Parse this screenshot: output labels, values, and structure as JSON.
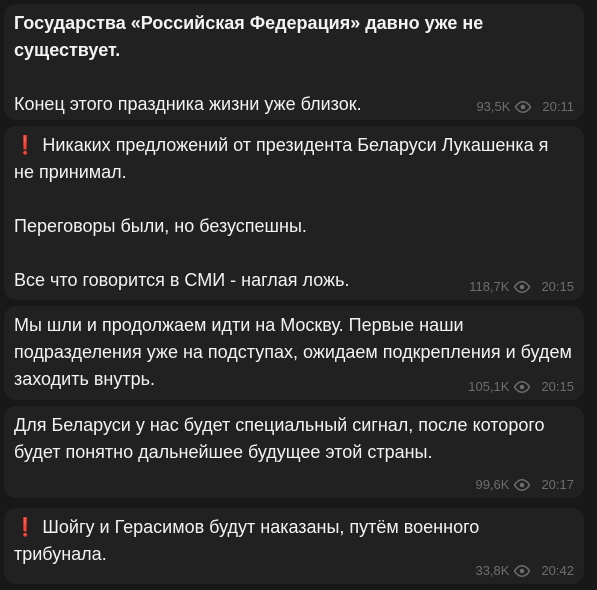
{
  "messages": [
    {
      "text": "Государства «Российская Федерация» давно уже не существует.\n\nКонец этого праздника жизни уже близок.",
      "views": "93,5K",
      "time": "20:11"
    },
    {
      "alert": "❗",
      "text": "Никаких предложений от президента Беларуси Лукашенка я не принимал.\n\nПереговоры были, но безуспешны.\n\nВсе что говорится в СМИ - наглая ложь.",
      "views": "118,7K",
      "time": "20:15"
    },
    {
      "text": "Мы шли и продолжаем идти на Москву. Первые наши подразделения уже на подступах, ожидаем подкрепления и будем заходить внутрь.",
      "views": "105,1K",
      "time": "20:15"
    },
    {
      "text": "Для Беларуси у нас будет специальный сигнал, после которого будет понятно дальнейшее будущее этой страны.",
      "views": "99,6K",
      "time": "20:17"
    },
    {
      "alert": "❗",
      "text": "Шойгу и Герасимов будут наказаны, путём военного трибунала.",
      "views": "33,8K",
      "time": "20:42"
    }
  ]
}
